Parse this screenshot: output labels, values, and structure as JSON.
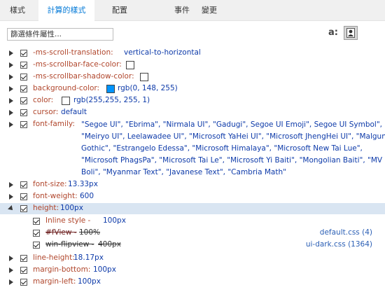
{
  "tabs": [
    {
      "label": "樣式",
      "active": false
    },
    {
      "label": "計算的樣式",
      "active": true
    },
    {
      "label": "配置",
      "active": false
    },
    {
      "label": "事件",
      "active": false
    },
    {
      "label": "變更",
      "active": false
    }
  ],
  "filter": {
    "placeholder": "篩選條件屬性..."
  },
  "view_buttons": [
    {
      "name": "text-view-icon",
      "glyph": "a:"
    },
    {
      "name": "user-view-icon"
    }
  ],
  "colors": {
    "accent": "#0078d7",
    "bg_color_swatch": "#0094ff",
    "white": "#ffffff"
  },
  "properties": {
    "scroll_translation": {
      "name": "-ms-scroll-translation:",
      "value": "vertical-to-horizontal"
    },
    "scrollbar_face": {
      "name": "-ms-scrollbar-face-color:"
    },
    "scrollbar_shadow": {
      "name": "-ms-scrollbar-shadow-color:"
    },
    "background_color": {
      "name": "background-color:",
      "value": "rgb(0, 148, 255)"
    },
    "color": {
      "name": "color:",
      "value": "rgb(255,255, 255, 1)"
    },
    "cursor": {
      "name": "cursor:",
      "value": "default"
    },
    "font_family": {
      "name": "font-family:",
      "lines": [
        "\"Segoe UI\", \"Ebrima\", \"Nirmala UI\", \"Gadugi\", Segoe UI Emoji\", Segoe UI Symbol\",",
        "\"Meiryo UI\", Leelawadee UI\", \"Microsoft YaHei UI\", \"Microsoft JhengHei UI\", \"Malgun",
        "Gothic\", \"Estrangelo Edessa\", \"Microsoft Himalaya\", \"Microsoft New Tai Lue\",",
        "\"Microsoft PhagsPa\", \"Microsoft Tai Le\", \"Microsoft Yi Baiti\", \"Mongolian Baiti\", \"MV",
        "Boli\", \"Myanmar Text\", \"Javanese Text\", \"Cambria Math\""
      ]
    },
    "font_size": {
      "name": "font-size:",
      "value": "13.33px"
    },
    "font_weight": {
      "name": "font-weight:",
      "value": "600"
    },
    "height": {
      "name": "height:",
      "value": "100px",
      "rules": [
        {
          "selector": "Inline style -",
          "value": "100px",
          "source": ""
        },
        {
          "selector": "#fView -",
          "value": "100%",
          "source": "default.css (4)"
        },
        {
          "selector": "win-flipview -",
          "value": "400px",
          "source": "ui-dark.css (1364)"
        }
      ]
    },
    "line_height": {
      "name": "line-height:",
      "value": "18.17px"
    },
    "margin_bottom": {
      "name": "margin-bottom:",
      "value": "100px"
    },
    "margin_left": {
      "name": "margin-left:",
      "value": "100px"
    }
  }
}
